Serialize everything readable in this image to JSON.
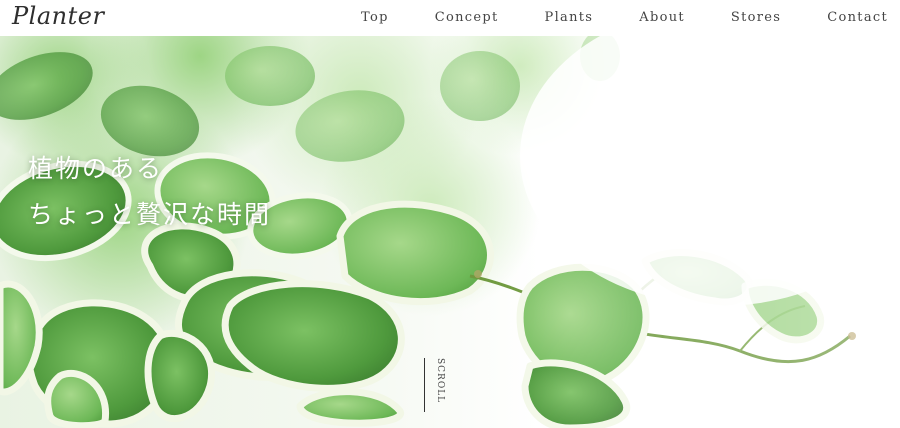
{
  "header": {
    "logo": "Planter",
    "nav": [
      {
        "label": "Top"
      },
      {
        "label": "Concept"
      },
      {
        "label": "Plants"
      },
      {
        "label": "About"
      },
      {
        "label": "Stores"
      },
      {
        "label": "Contact"
      }
    ]
  },
  "hero": {
    "image": "variegated-ivy-leaves-photo",
    "catch_line1": "植物のある",
    "catch_line2": "ちょっと贅沢な時間",
    "scroll_label": "SCROLL"
  },
  "colors": {
    "text": "#444444",
    "catch_text": "#ffffff",
    "leaf_green": "#5fa84a",
    "leaf_edge": "#f2f7e8"
  }
}
